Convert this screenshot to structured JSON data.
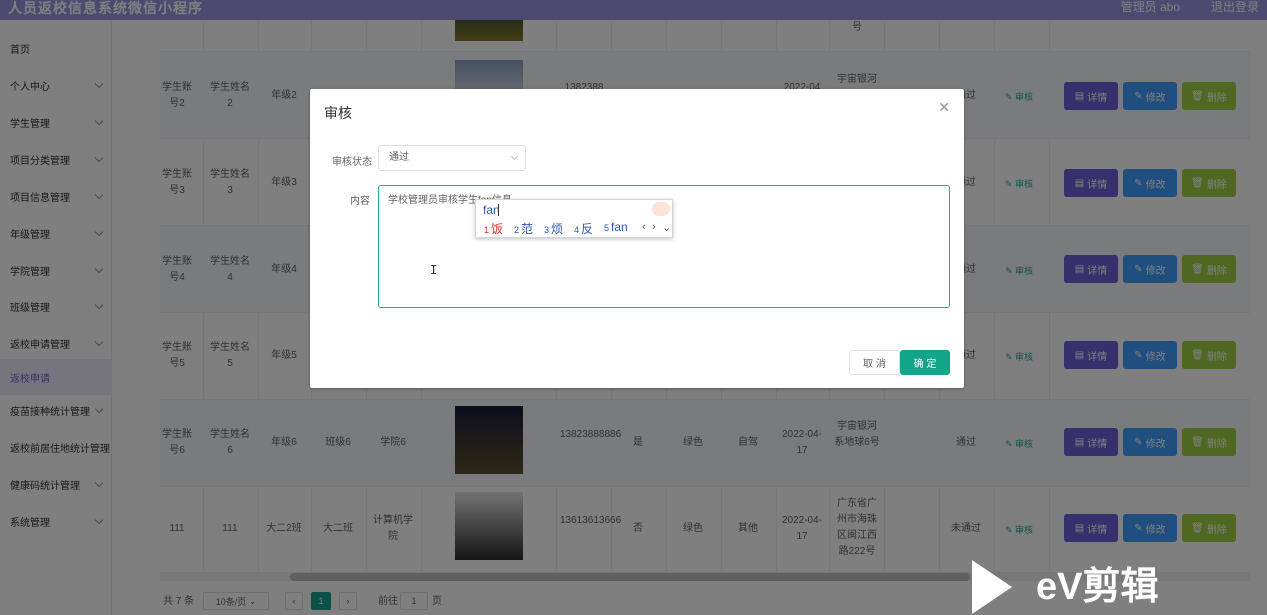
{
  "header": {
    "title": "人员返校信息系统微信小程序",
    "user": "管理员 abo",
    "logout": "退出登录"
  },
  "sidebar": {
    "items": [
      {
        "label": "首页",
        "has_arrow": false
      },
      {
        "label": "个人中心",
        "has_arrow": true
      },
      {
        "label": "学生管理",
        "has_arrow": true
      },
      {
        "label": "项目分类管理",
        "has_arrow": true
      },
      {
        "label": "项目信息管理",
        "has_arrow": true
      },
      {
        "label": "年级管理",
        "has_arrow": true
      },
      {
        "label": "学院管理",
        "has_arrow": true
      },
      {
        "label": "班级管理",
        "has_arrow": true
      },
      {
        "label": "返校申请管理",
        "has_arrow": true
      },
      {
        "label": "返校申请",
        "has_arrow": false,
        "active": true
      },
      {
        "label": "疫苗接种统计管理",
        "has_arrow": true
      },
      {
        "label": "返校前居住地统计管理",
        "has_arrow": false
      },
      {
        "label": "健康码统计管理",
        "has_arrow": true
      },
      {
        "label": "系统管理",
        "has_arrow": true
      }
    ]
  },
  "table": {
    "top_row": {
      "address_tail": "号"
    },
    "rows": [
      {
        "account": "学生账号2",
        "name": "学生姓名2",
        "grade": "年级2",
        "phone": "1382388",
        "date": "2022-04",
        "address": "宇宙银河",
        "status": "通过"
      },
      {
        "account": "学生账号3",
        "name": "学生姓名3",
        "grade": "年级3",
        "status": "通过"
      },
      {
        "account": "学生账号4",
        "name": "学生姓名4",
        "grade": "年级4",
        "status": "通过"
      },
      {
        "account": "学生账号5",
        "name": "学生姓名5",
        "grade": "年级5",
        "status": "通过"
      },
      {
        "account": "学生账号6",
        "name": "学生姓名6",
        "grade": "年级6",
        "class": "班级6",
        "college": "学院6",
        "phone": "13823888886",
        "vaccinated": "是",
        "code": "绿色",
        "transport": "自驾",
        "date": "2022-04-17",
        "address": "宇宙银河系地球6号",
        "status": "通过"
      },
      {
        "account": "111",
        "name": "111",
        "grade": "大二2班",
        "class": "大二班",
        "college": "计算机学院",
        "phone": "13613613666",
        "vaccinated": "否",
        "code": "绿色",
        "transport": "其他",
        "date": "2022-04-17",
        "address": "广东省广州市海珠区闽江西路222号",
        "status": "未通过"
      }
    ],
    "actions": {
      "audit": "审核",
      "detail": "详情",
      "edit": "修改",
      "delete": "删除"
    }
  },
  "pagination": {
    "total": "共 7 条",
    "page_size": "10条/页",
    "current_page": "1",
    "goto_label": "前往",
    "goto_value": "1",
    "page_unit": "页"
  },
  "dialog": {
    "title": "审核",
    "status_label": "审核状态",
    "status_value": "通过",
    "content_label": "内容",
    "content_value": "学校管理员审核学生fan信息",
    "cancel": "取 消",
    "confirm": "确 定"
  },
  "ime": {
    "typed": "fan",
    "candidates": [
      {
        "num": "1",
        "text": "饭"
      },
      {
        "num": "2",
        "text": "范"
      },
      {
        "num": "3",
        "text": "烦"
      },
      {
        "num": "4",
        "text": "反"
      },
      {
        "num": "5",
        "text": "fan"
      }
    ]
  },
  "watermark": {
    "text": "eV剪辑"
  },
  "colors": {
    "accent": "#6c63d9",
    "primary": "#409eff",
    "success": "#12a58a",
    "danger_green": "#a0cf45"
  }
}
